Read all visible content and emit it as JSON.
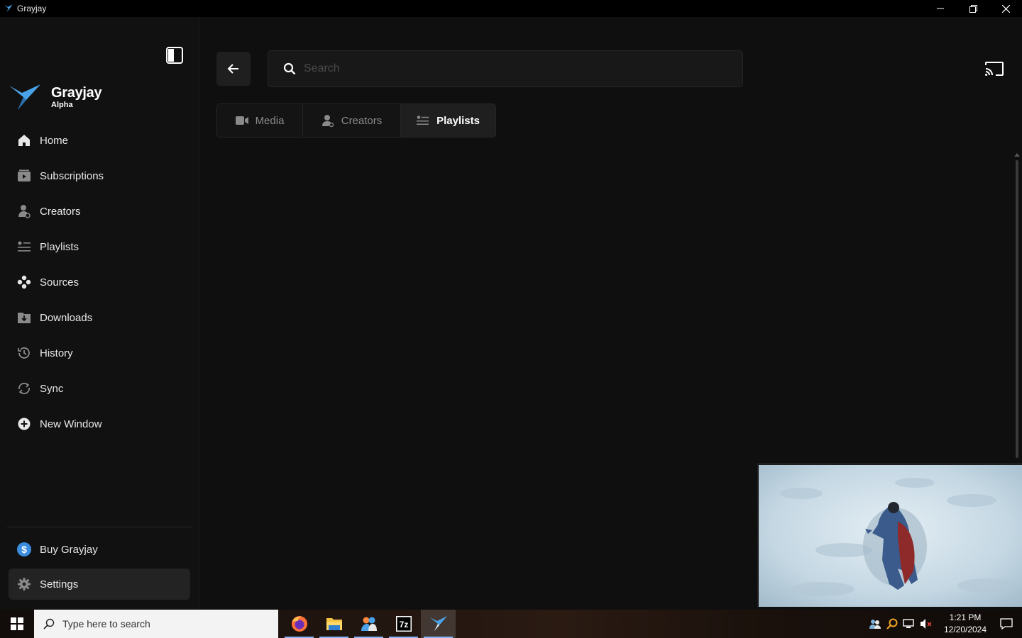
{
  "window": {
    "title": "Grayjay",
    "controls": [
      "minimize",
      "maximize",
      "close"
    ]
  },
  "sidebar": {
    "logo": {
      "name": "Grayjay",
      "sub": "Alpha"
    },
    "items": [
      {
        "label": "Home",
        "icon": "home-icon"
      },
      {
        "label": "Subscriptions",
        "icon": "subscriptions-icon"
      },
      {
        "label": "Creators",
        "icon": "creators-icon"
      },
      {
        "label": "Playlists",
        "icon": "playlists-icon"
      },
      {
        "label": "Sources",
        "icon": "sources-icon"
      },
      {
        "label": "Downloads",
        "icon": "downloads-icon"
      },
      {
        "label": "History",
        "icon": "history-icon"
      },
      {
        "label": "Sync",
        "icon": "sync-icon"
      },
      {
        "label": "New Window",
        "icon": "new-window-icon"
      }
    ],
    "footer": [
      {
        "label": "Buy Grayjay",
        "icon": "dollar-icon"
      },
      {
        "label": "Settings",
        "icon": "gear-icon"
      }
    ]
  },
  "main": {
    "search": {
      "placeholder": "Search",
      "value": ""
    },
    "tabs": [
      {
        "label": "Media",
        "icon": "camera-icon",
        "active": false
      },
      {
        "label": "Creators",
        "icon": "person-icon",
        "active": false
      },
      {
        "label": "Playlists",
        "icon": "list-icon",
        "active": true
      }
    ]
  },
  "taskbar": {
    "search_text": "Type here to search",
    "apps": [
      "firefox-icon",
      "file-explorer-icon",
      "app-icon",
      "7zip-icon",
      "grayjay-icon"
    ],
    "clock": {
      "time": "1:21 PM",
      "date": "12/20/2024"
    }
  },
  "colors": {
    "background": "#0f0f0f",
    "sidebar": "#111111",
    "accent": "#3a8dde"
  }
}
